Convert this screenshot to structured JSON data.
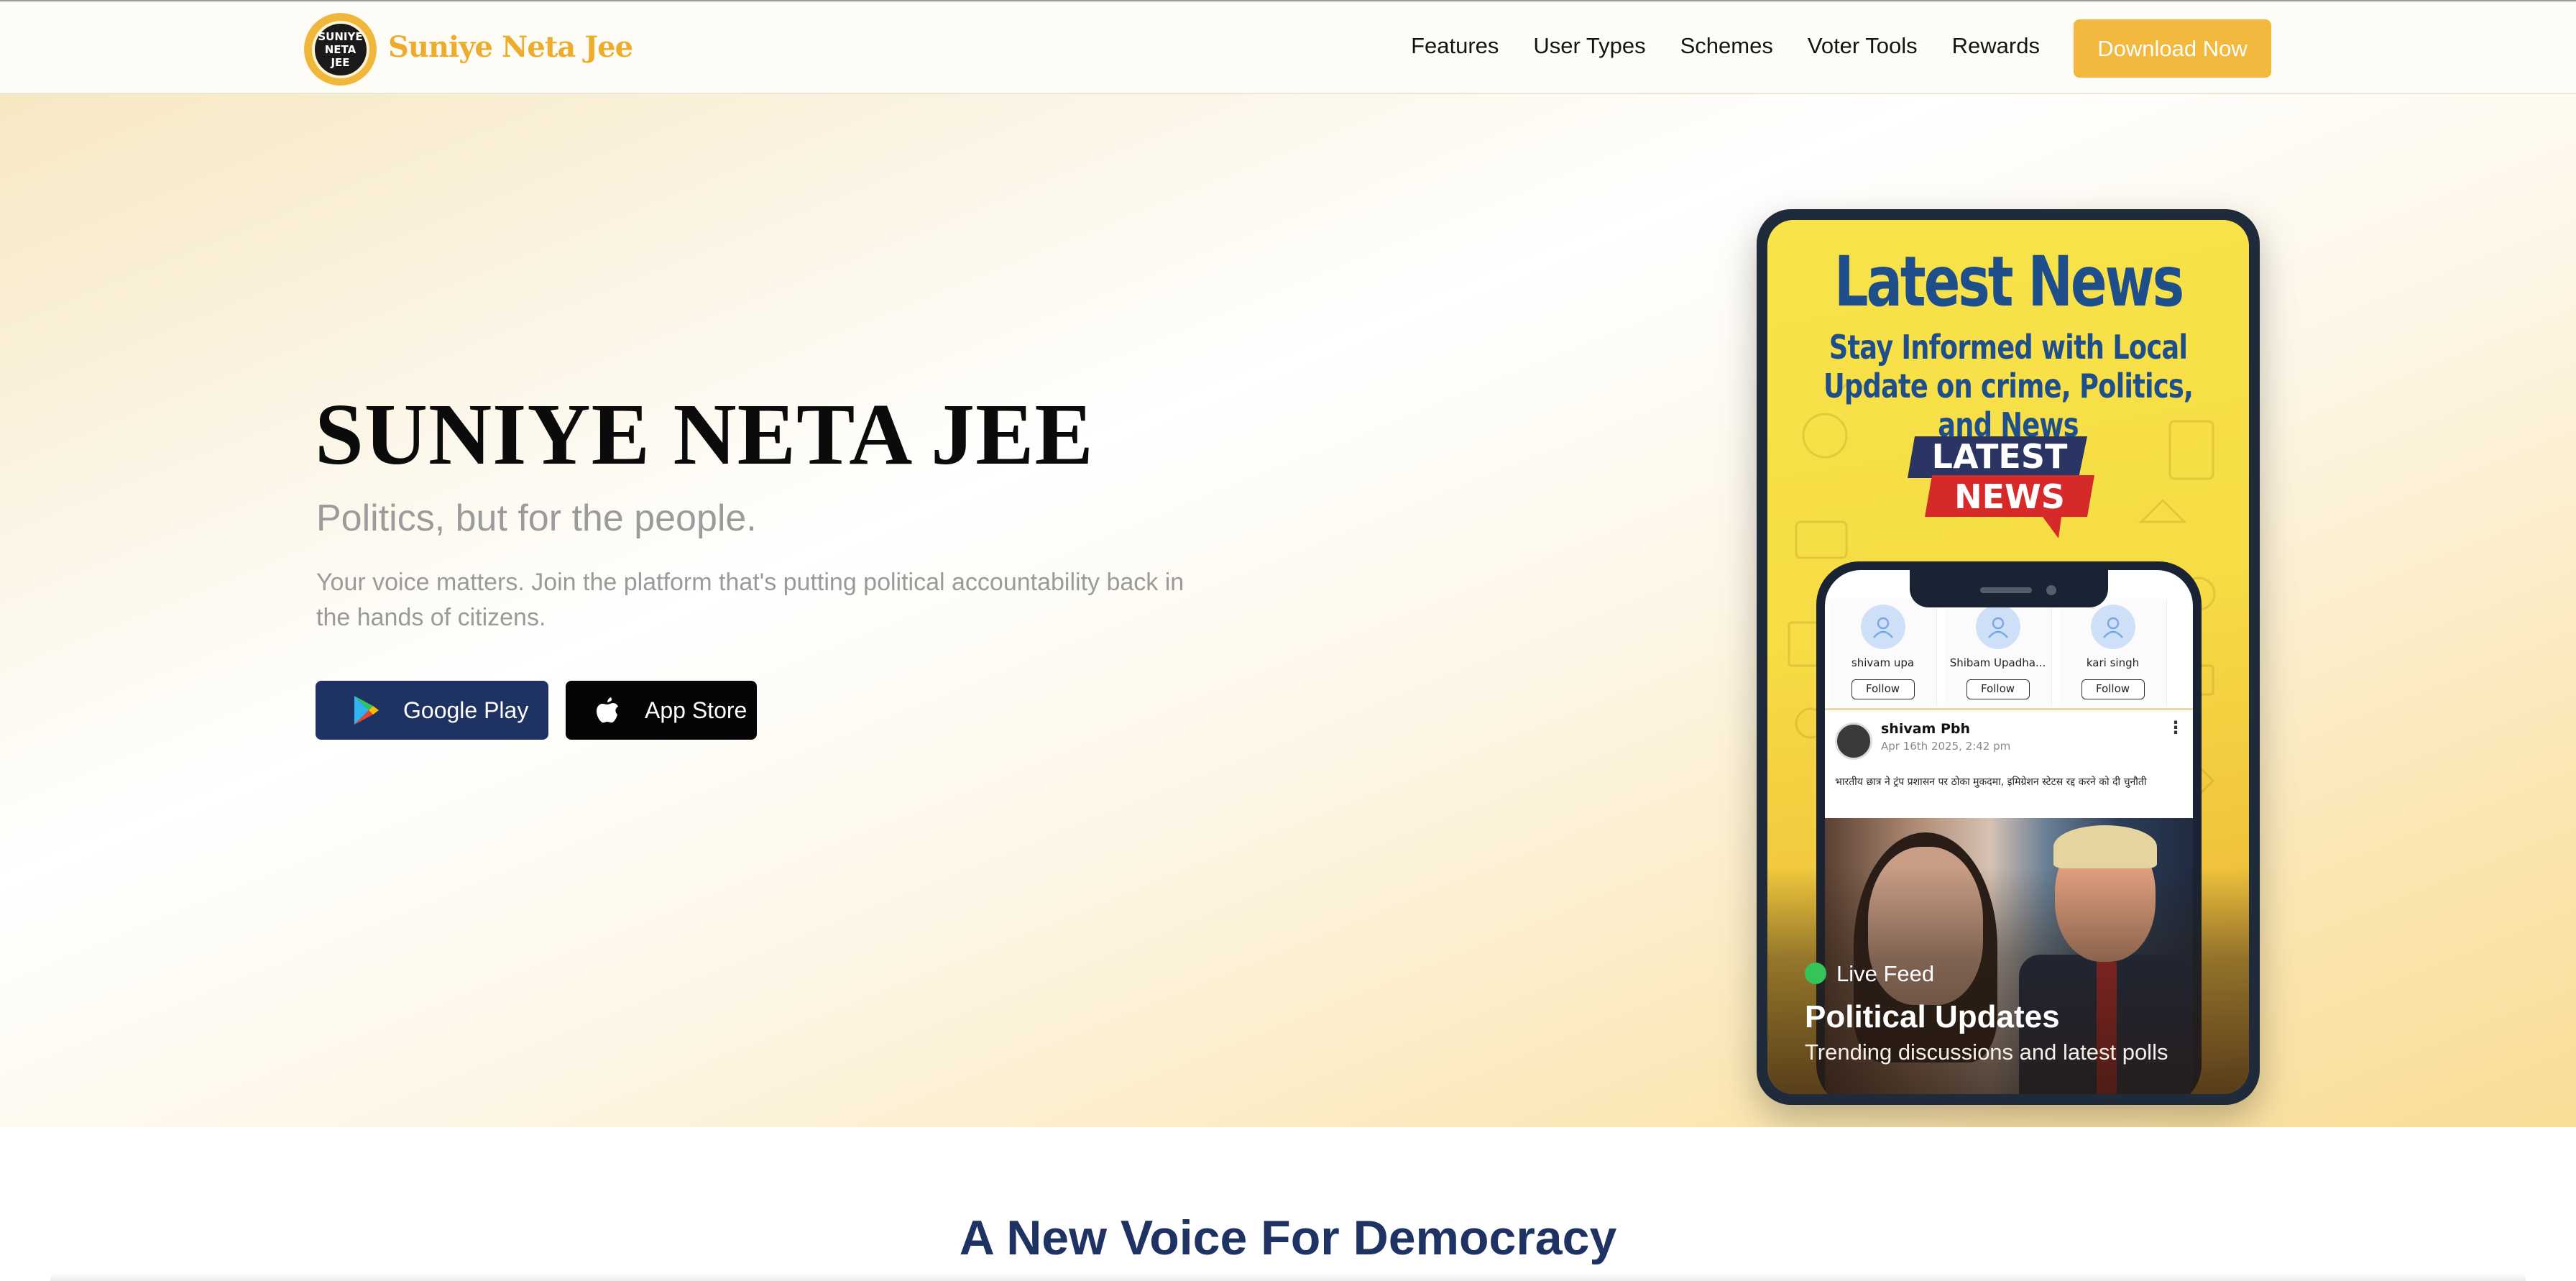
{
  "nav": {
    "brand": "Suniye Neta Jee",
    "logo_text_line1": "SUNIYE",
    "logo_text_line2": "NETA JEE",
    "links": [
      "Features",
      "User Types",
      "Schemes",
      "Voter Tools",
      "Rewards"
    ],
    "cta": "Download Now"
  },
  "hero": {
    "title": "SUNIYE NETA JEE",
    "subtitle": "Politics, but for the people.",
    "description": "Your voice matters. Join the platform that's putting political accountability back in the hands of citizens.",
    "google_play": "Google Play",
    "app_store": "App Store"
  },
  "phone": {
    "heading": "Latest News",
    "subheading": "Stay Informed with Local Update on crime, Politics, and News",
    "badge_line1": "LATEST",
    "badge_line2": "NEWS",
    "suggestions": [
      {
        "name": "shivam upa",
        "follow": "Follow"
      },
      {
        "name": "Shibam Upadha...",
        "follow": "Follow"
      },
      {
        "name": "kari singh",
        "follow": "Follow"
      }
    ],
    "post": {
      "author": "shivam Pbh",
      "date": "Apr 16th 2025, 2:42 pm",
      "text": "भारतीय छात्र ने ट्रंप प्रशासन पर ठोका मुकदमा, इमिग्रेशन स्टेटस रद्द करने को दी चुनौती"
    },
    "live_label": "Live Feed",
    "overlay_title": "Political Updates",
    "overlay_sub": "Trending discussions and latest polls"
  },
  "section": {
    "title": "A New Voice For Democracy"
  },
  "colors": {
    "accent": "#f3b83e",
    "navy": "#1e3263",
    "live": "#34c45a"
  }
}
